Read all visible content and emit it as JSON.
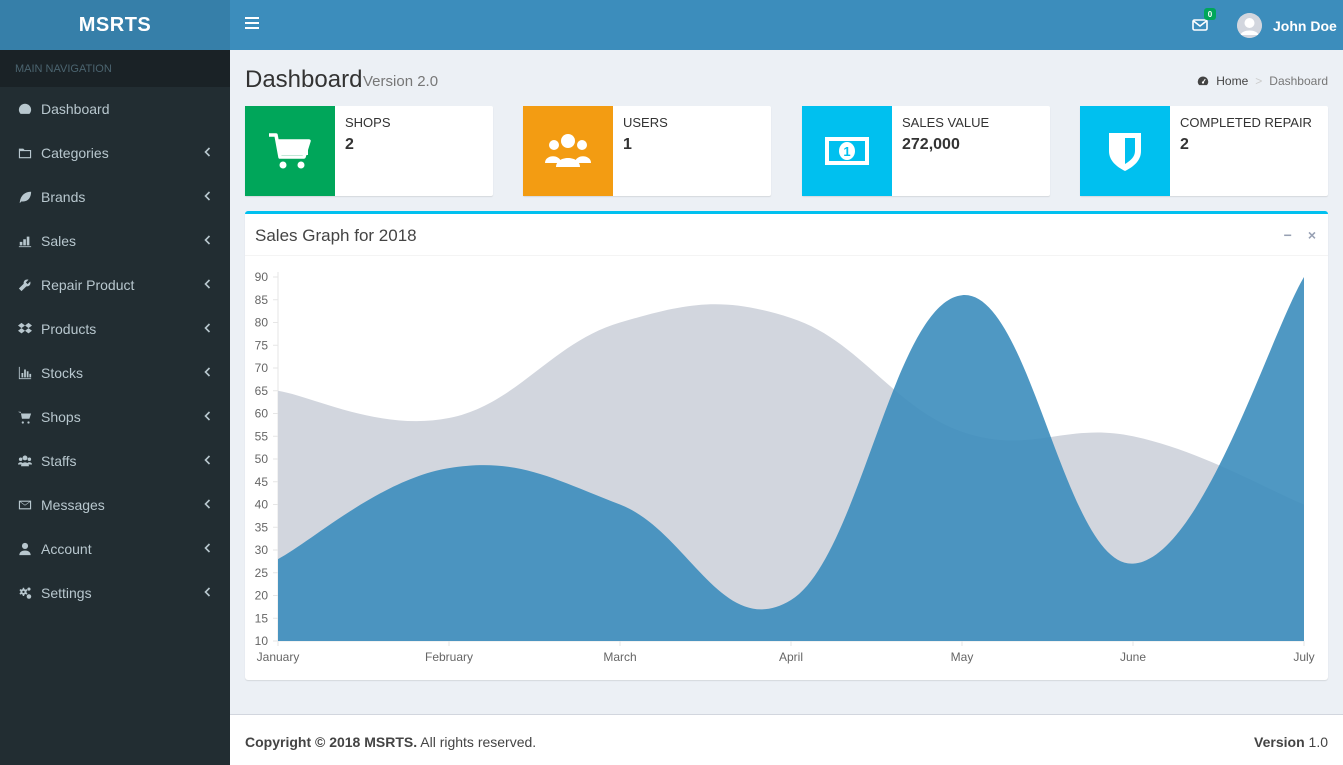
{
  "app": {
    "logo": "MSRTS"
  },
  "sidebar": {
    "header": "MAIN NAVIGATION",
    "items": [
      {
        "label": "Dashboard",
        "icon": "dashboard-icon",
        "has_submenu": false
      },
      {
        "label": "Categories",
        "icon": "folder-icon",
        "has_submenu": true
      },
      {
        "label": "Brands",
        "icon": "leaf-icon",
        "has_submenu": true
      },
      {
        "label": "Sales",
        "icon": "bar-chart-icon",
        "has_submenu": true
      },
      {
        "label": "Repair Product",
        "icon": "wrench-icon",
        "has_submenu": true
      },
      {
        "label": "Products",
        "icon": "dropbox-icon",
        "has_submenu": true
      },
      {
        "label": "Stocks",
        "icon": "stats-icon",
        "has_submenu": true
      },
      {
        "label": "Shops",
        "icon": "cart-icon",
        "has_submenu": true
      },
      {
        "label": "Staffs",
        "icon": "users-icon",
        "has_submenu": true
      },
      {
        "label": "Messages",
        "icon": "envelope-icon",
        "has_submenu": true
      },
      {
        "label": "Account",
        "icon": "user-icon",
        "has_submenu": true
      },
      {
        "label": "Settings",
        "icon": "gears-icon",
        "has_submenu": true
      }
    ]
  },
  "header": {
    "mail_count": "0",
    "user_name": "John Doe"
  },
  "content_header": {
    "title": "Dashboard",
    "subtitle": "Version 2.0",
    "breadcrumb": {
      "home": "Home",
      "current": "Dashboard"
    }
  },
  "info_boxes": [
    {
      "label": "SHOPS",
      "value": "2",
      "color": "#00a65a",
      "icon": "cart-icon"
    },
    {
      "label": "USERS",
      "value": "1",
      "color": "#f39c12",
      "icon": "users-icon"
    },
    {
      "label": "SALES VALUE",
      "value": "272,000",
      "color": "#00c0ef",
      "icon": "money-icon"
    },
    {
      "label": "COMPLETED REPAIR",
      "value": "2",
      "color": "#00c0ef",
      "icon": "shield-icon"
    }
  ],
  "chart_box": {
    "title": "Sales Graph for 2018",
    "tools": {
      "collapse": "−",
      "remove": "×"
    }
  },
  "chart_data": {
    "type": "area",
    "categories": [
      "January",
      "February",
      "March",
      "April",
      "May",
      "June",
      "July"
    ],
    "series": [
      {
        "values": [
          65,
          59,
          80,
          81,
          56,
          55,
          40
        ],
        "color": "#d2d6de"
      },
      {
        "values": [
          28,
          48,
          40,
          19,
          86,
          27,
          90
        ],
        "color": "#3c8dbc"
      }
    ],
    "yticks": [
      10,
      15,
      20,
      25,
      30,
      35,
      40,
      45,
      50,
      55,
      60,
      65,
      70,
      75,
      80,
      85,
      90
    ],
    "ylim": [
      10,
      90
    ]
  },
  "footer": {
    "copyright_bold": "Copyright © 2018 MSRTS.",
    "copyright_rest": " All rights reserved.",
    "version_label": "Version",
    "version_value": " 1.0"
  }
}
